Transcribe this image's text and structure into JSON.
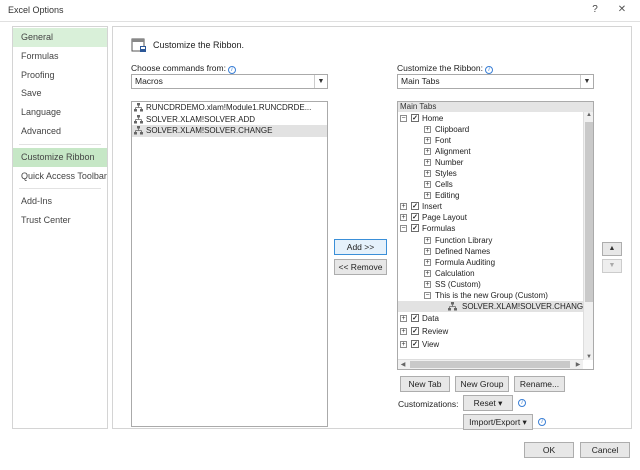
{
  "window": {
    "title": "Excel Options",
    "help_glyph": "?",
    "close_glyph": "✕"
  },
  "sidebar": {
    "items": [
      {
        "label": "General"
      },
      {
        "label": "Formulas"
      },
      {
        "label": "Proofing"
      },
      {
        "label": "Save"
      },
      {
        "label": "Language"
      },
      {
        "label": "Advanced"
      },
      {
        "label": "Customize Ribbon"
      },
      {
        "label": "Quick Access Toolbar"
      },
      {
        "label": "Add-Ins"
      },
      {
        "label": "Trust Center"
      }
    ]
  },
  "main": {
    "heading": "Customize the Ribbon.",
    "left": {
      "label": "Choose commands from:",
      "combo_value": "Macros",
      "items": [
        "RUNCDRDEMO.xlam!Module1.RUNCDRDE...",
        "SOLVER.XLAM!SOLVER.ADD",
        "SOLVER.XLAM!SOLVER.CHANGE"
      ]
    },
    "right": {
      "label": "Customize the Ribbon:",
      "combo_value": "Main Tabs",
      "tree_header": "Main Tabs",
      "tree": [
        {
          "label": "Home"
        },
        {
          "label": "Clipboard"
        },
        {
          "label": "Font"
        },
        {
          "label": "Alignment"
        },
        {
          "label": "Number"
        },
        {
          "label": "Styles"
        },
        {
          "label": "Cells"
        },
        {
          "label": "Editing"
        },
        {
          "label": "Insert"
        },
        {
          "label": "Page Layout"
        },
        {
          "label": "Formulas"
        },
        {
          "label": "Function Library"
        },
        {
          "label": "Defined Names"
        },
        {
          "label": "Formula Auditing"
        },
        {
          "label": "Calculation"
        },
        {
          "label": "SS (Custom)"
        },
        {
          "label": "This is the new Group (Custom)"
        },
        {
          "label": "SOLVER.XLAM!SOLVER.CHANGE"
        },
        {
          "label": "Data"
        },
        {
          "label": "Review"
        },
        {
          "label": "View"
        }
      ]
    },
    "buttons": {
      "add": "Add >>",
      "remove": "<< Remove",
      "new_tab": "New Tab",
      "new_group": "New Group",
      "rename": "Rename...",
      "customizations": "Customizations:",
      "reset": "Reset ▾",
      "import_export": "Import/Export ▾",
      "ok": "OK",
      "cancel": "Cancel",
      "move_up_glyph": "▲",
      "move_down_glyph": "▼"
    }
  }
}
